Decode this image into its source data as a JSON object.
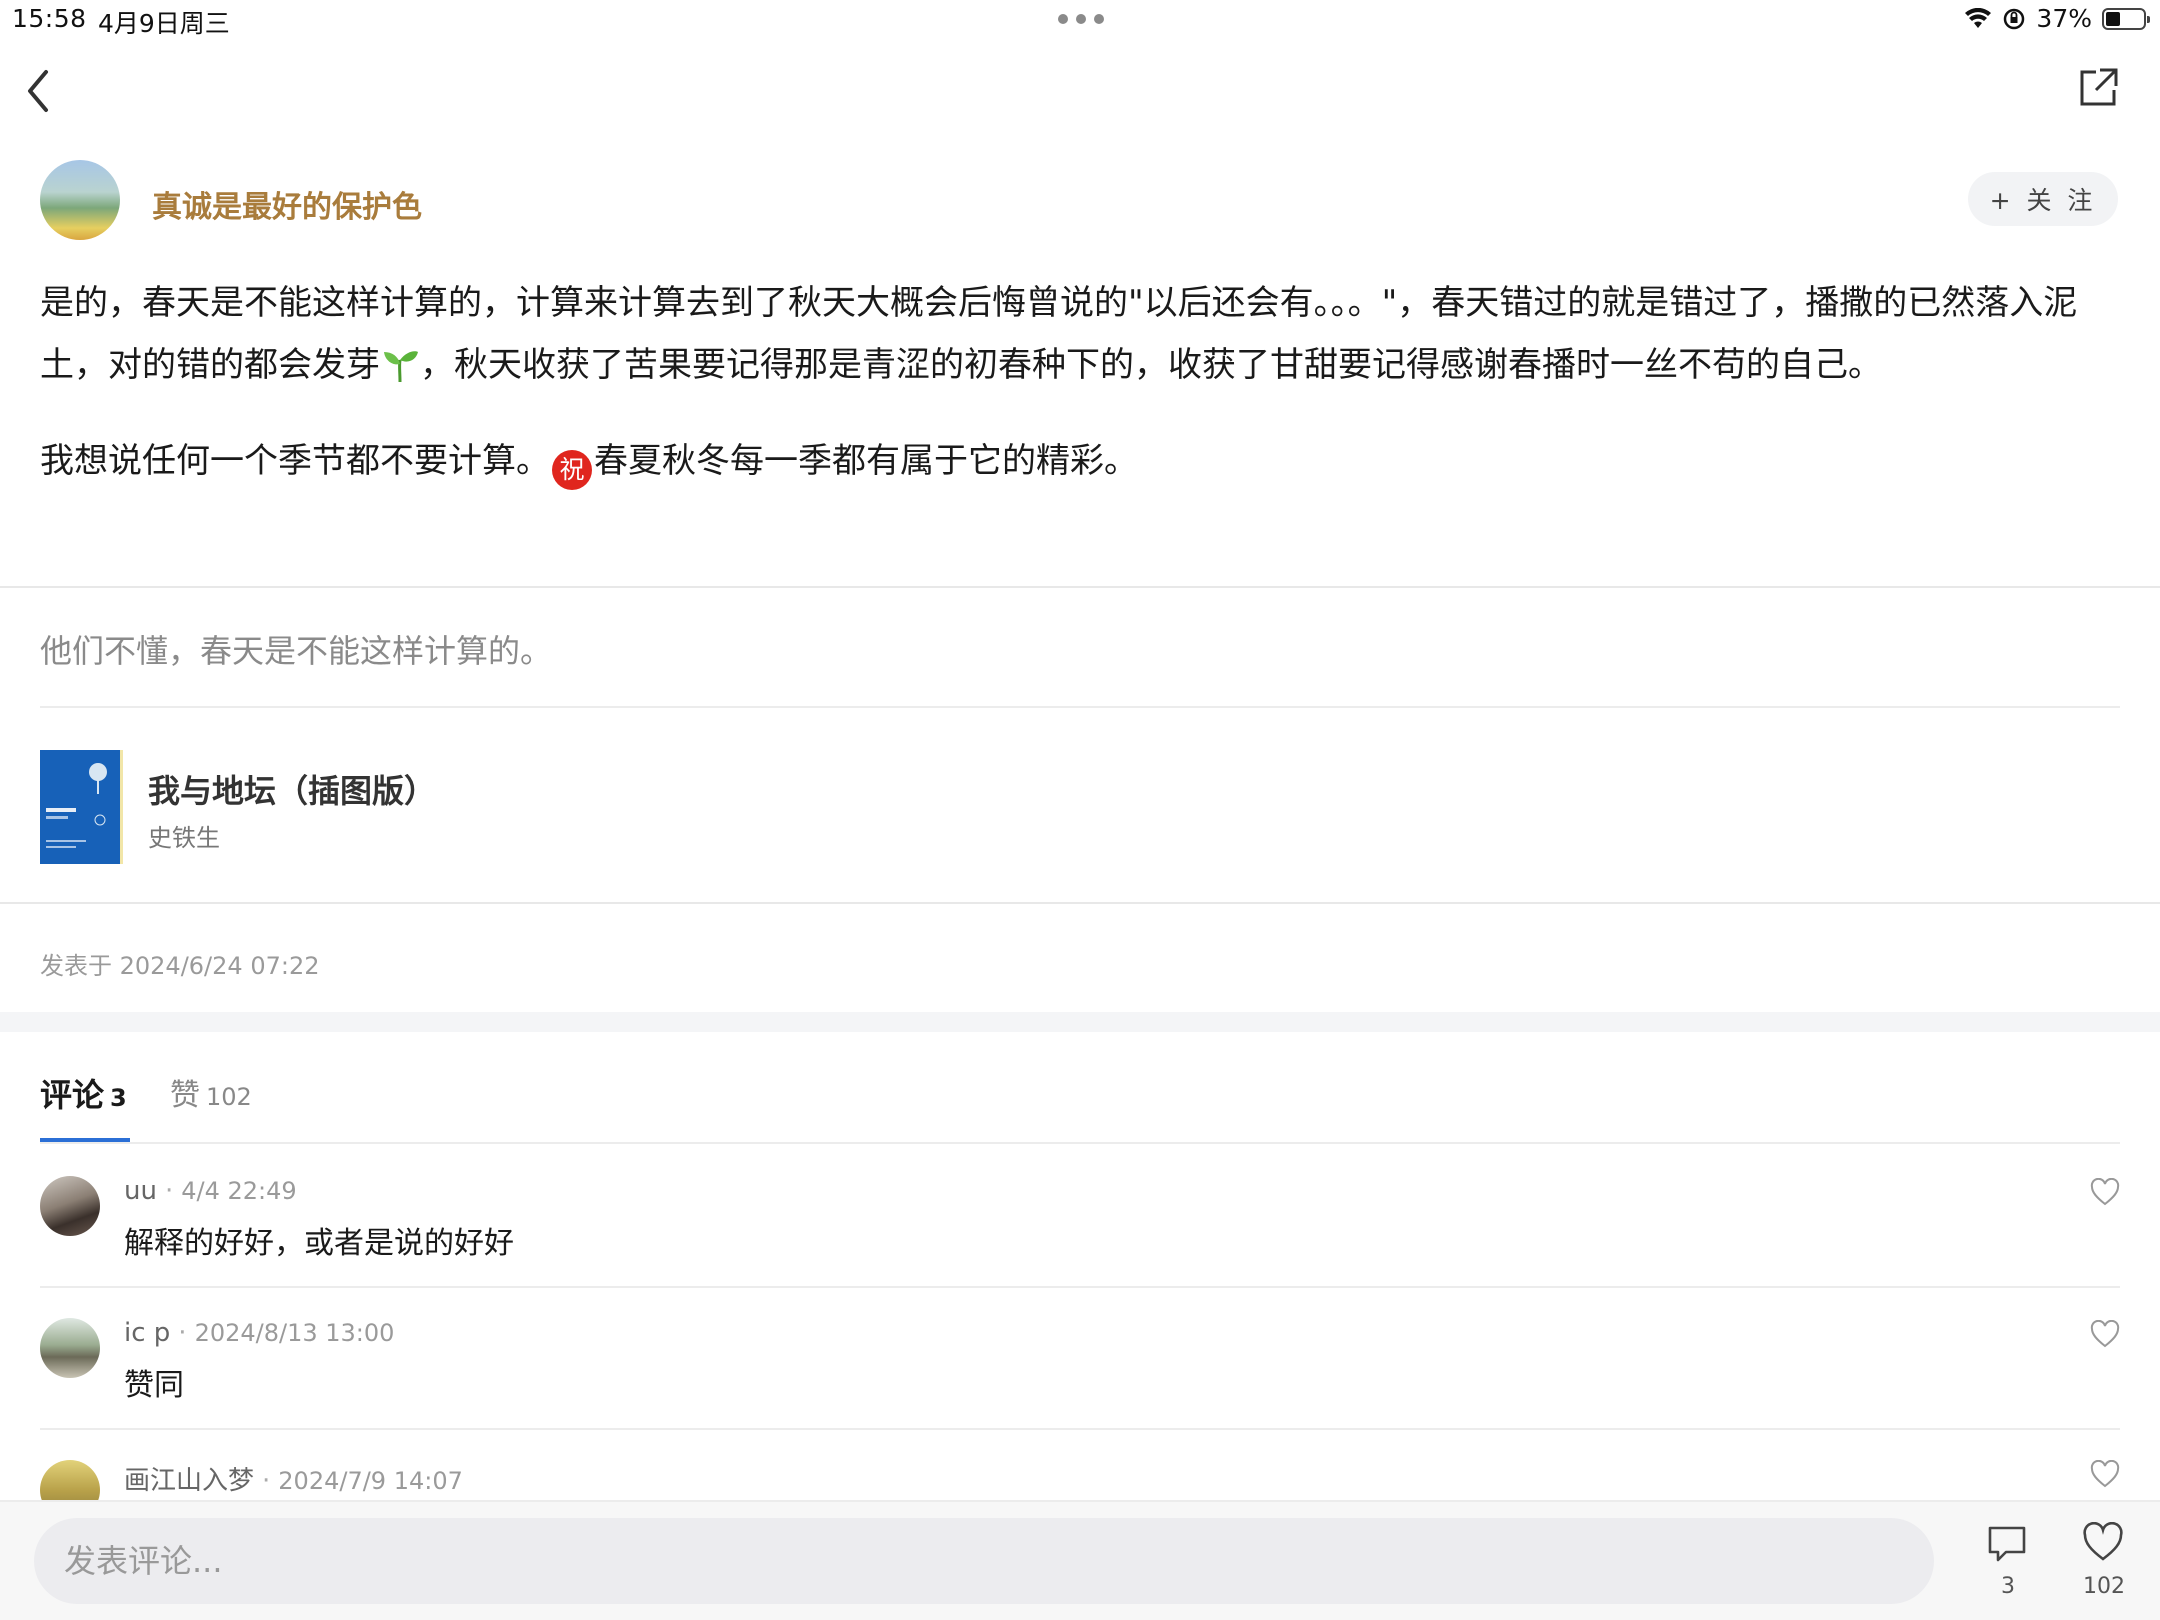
{
  "status_bar": {
    "time": "15:58",
    "date": "4月9日周三",
    "battery": "37%",
    "battery_level": 0.37
  },
  "author": {
    "name": "真诚是最好的保护色",
    "follow_label": "+ 关 注"
  },
  "post": {
    "para1_a": "是的，春天是不能这样计算的，计算来计算去到了秋天大概会后悔曾说的\"以后还会有。。。\"，春天错过的就是错过了，播撒的已然落入泥土，对的错的都会发芽",
    "para1_b": "，秋天收获了苦果要记得那是青涩的初春种下的，收获了甘甜要记得感谢春播时一丝不苟的自己。",
    "para2_a": "我想说任何一个季节都不要计算。",
    "emoji_zhu": "祝",
    "para2_b": "春夏秋冬每一季都有属于它的精彩。",
    "quote": "他们不懂，春天是不能这样计算的。"
  },
  "book": {
    "title": "我与地坛（插图版）",
    "author": "史铁生"
  },
  "posted_at": "发表于 2024/6/24 07:22",
  "tabs": {
    "comments_label": "评论",
    "comments_count": "3",
    "likes_label": "赞",
    "likes_count": "102"
  },
  "comments": [
    {
      "name": "uu",
      "time": "4/4 22:49",
      "text": "解释的好好，或者是说的好好"
    },
    {
      "name": "ic p",
      "time": "2024/8/13 13:00",
      "text": "赞同"
    },
    {
      "name": "画江山入梦",
      "time": "2024/7/9 14:07",
      "text": ""
    }
  ],
  "bottom_bar": {
    "input_placeholder": "发表评论...",
    "comment_count": "3",
    "like_count": "102"
  },
  "colors": {
    "author_name": "#a97c3c",
    "tab_underline": "#2b6fd6",
    "book_cover": "#1761b8",
    "emoji_red": "#e0261e"
  }
}
